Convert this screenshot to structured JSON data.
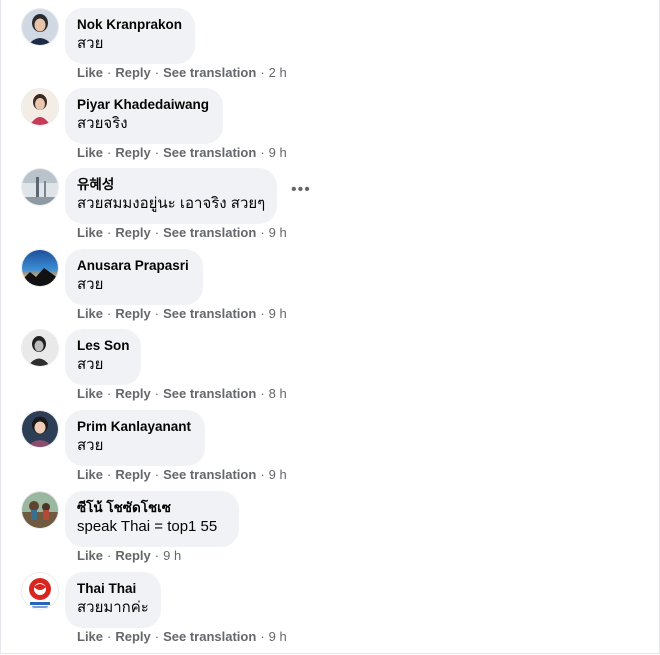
{
  "actions": {
    "like": "Like",
    "reply": "Reply",
    "see_translation": "See translation",
    "separator": "·"
  },
  "more_options": "•••",
  "comments": [
    {
      "author": "Nok Kranprakon",
      "text": "สวย",
      "time": "2 h"
    },
    {
      "author": "Piyar Khadedaiwang",
      "text": "สวยจริง",
      "time": "9 h"
    },
    {
      "author": "유혜성",
      "text": "สวยสมมงอยู่นะ เอาจริง สวยๆ",
      "time": "9 h"
    },
    {
      "author": "Anusara Prapasri",
      "text": "สวย",
      "time": "9 h"
    },
    {
      "author": "Les Son",
      "text": "สวย",
      "time": "8 h"
    },
    {
      "author": "Prim Kanlayanant",
      "text": "สวย",
      "time": "9 h"
    },
    {
      "author": "ซีโน้ โชซัดโชเซ",
      "text": "speak Thai = top1 55",
      "time": "9 h"
    },
    {
      "author": "Thai Thai",
      "text": "สวยมากค่ะ",
      "time": "9 h"
    }
  ]
}
